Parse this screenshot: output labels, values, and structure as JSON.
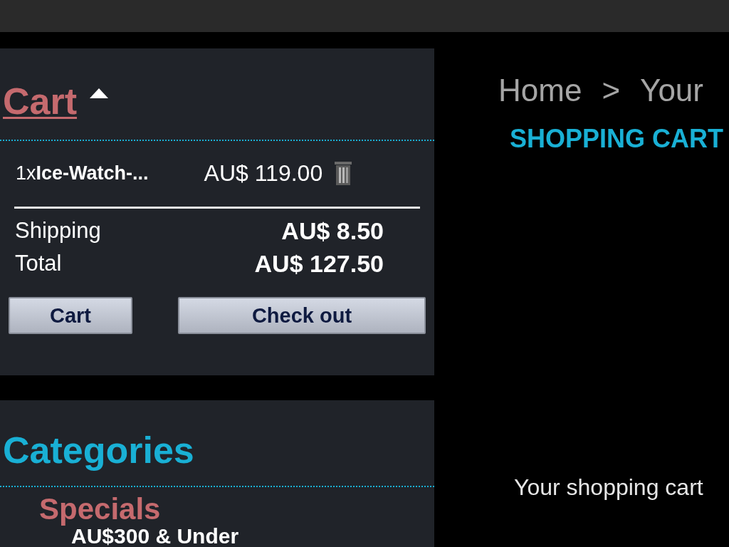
{
  "cart": {
    "title": "Cart",
    "expanded": true,
    "items": [
      {
        "quantity": "1x",
        "name": "Ice-Watch-...",
        "price": "AU$ 119.00"
      }
    ],
    "summary": [
      {
        "label": "Shipping",
        "value": "AU$ 8.50"
      },
      {
        "label": "Total",
        "value": "AU$ 127.50"
      }
    ],
    "buttons": [
      "Cart",
      "Check out"
    ]
  },
  "categories": {
    "title": "Categories",
    "groups": [
      {
        "name": "Specials",
        "children": [
          {
            "name": "AU$300 & Under"
          }
        ]
      }
    ]
  },
  "breadcrumb": [
    "Home",
    ">",
    "Your"
  ],
  "heading": "SHOPPING CART",
  "message": "Your shopping cart"
}
